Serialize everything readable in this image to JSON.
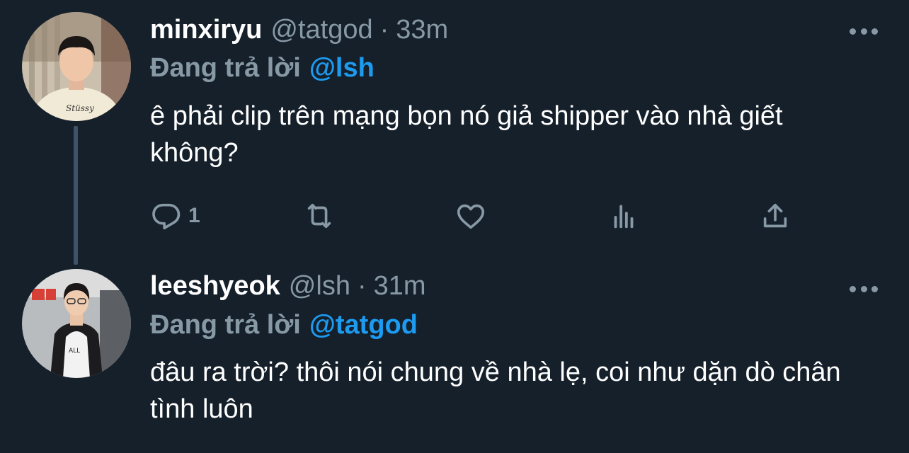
{
  "tweets": [
    {
      "display_name": "minxiryu",
      "handle": "@tatgod",
      "separator": "·",
      "time": "33m",
      "reply_prefix": "Đang trả lời",
      "reply_to": "@lsh",
      "text": "ê phải clip trên mạng bọn nó giả shipper vào nhà giết không?",
      "reply_count": "1"
    },
    {
      "display_name": "leeshyeok",
      "handle": "@lsh",
      "separator": "·",
      "time": "31m",
      "reply_prefix": "Đang trả lời",
      "reply_to": "@tatgod",
      "text": "đâu ra trời? thôi nói chung về nhà lẹ, coi như dặn dò chân tình luôn"
    }
  ],
  "icons": {
    "more": "more-horizontal-icon",
    "reply": "reply-bubble-icon",
    "retweet": "retweet-icon",
    "like": "heart-icon",
    "views": "views-bar-chart-icon",
    "share": "share-upload-icon"
  },
  "colors": {
    "background": "#15202b",
    "primary_text": "#ffffff",
    "secondary_text": "#8899a6",
    "accent": "#1d9bf0",
    "thread_line": "#3d5466"
  }
}
